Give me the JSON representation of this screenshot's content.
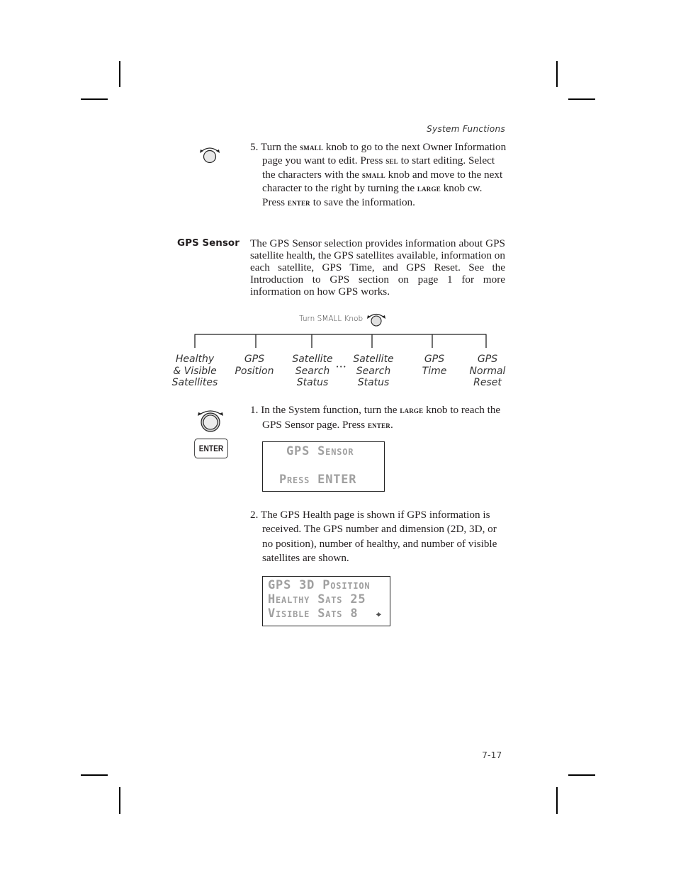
{
  "header": {
    "section_title": "System Functions"
  },
  "step5": {
    "number": "5.",
    "t1": "Turn the ",
    "k1": "SMALL",
    "t2": " knob to go to the next Owner Information page you want to edit. Press ",
    "k2": "SEL",
    "t3": " to start editing. Select the characters with the ",
    "k3": "SMALL",
    "t4": " knob and move to the next character to the right by turning the ",
    "k4": "LARGE",
    "t5": " knob cw. Press ",
    "k5": "ENTER",
    "t6": " to save the information."
  },
  "gps_sensor": {
    "heading": "GPS Sensor",
    "description": "The GPS Sensor selection provides information about GPS satellite health, the GPS satellites available, information on each satellite, GPS Time, and GPS Reset. See the Introduction to GPS section on page 1 for more information on how GPS works."
  },
  "diagram": {
    "caption": "Turn SMALL Knob",
    "icon": "small-knob-icon",
    "ellipsis": "•••",
    "pages": [
      {
        "lines": [
          "Healthy",
          "& Visible",
          "Satellites"
        ]
      },
      {
        "lines": [
          "GPS",
          "Position"
        ]
      },
      {
        "lines": [
          "Satellite",
          "Search",
          "Status"
        ]
      },
      {
        "lines": [
          "Satellite",
          "Search",
          "Status"
        ]
      },
      {
        "lines": [
          "GPS",
          "Time"
        ]
      },
      {
        "lines": [
          "GPS",
          "Normal",
          "Reset"
        ]
      }
    ]
  },
  "step1": {
    "number": "1.",
    "t1": "In the System function, turn the ",
    "k1": "LARGE",
    "t2": " knob to reach the GPS Sensor page. Press ",
    "k2": "ENTER",
    "t3": "."
  },
  "enter_button": {
    "label": "ENTER"
  },
  "lcd1": {
    "line1": "GPS Sensor",
    "line2": "Press ENTER"
  },
  "step2": {
    "number": "2.",
    "text": "The GPS Health page is shown if GPS information is received. The GPS number and dimension (2D, 3D, or no position), number of healthy, and number of visible satellites are shown."
  },
  "lcd2": {
    "line1": "GPS 3D Position",
    "line2": "Healthy Sats 25",
    "line3": "Visible Sats 8",
    "cursor_icon": "⌖"
  },
  "footer": {
    "page_number": "7-17"
  }
}
